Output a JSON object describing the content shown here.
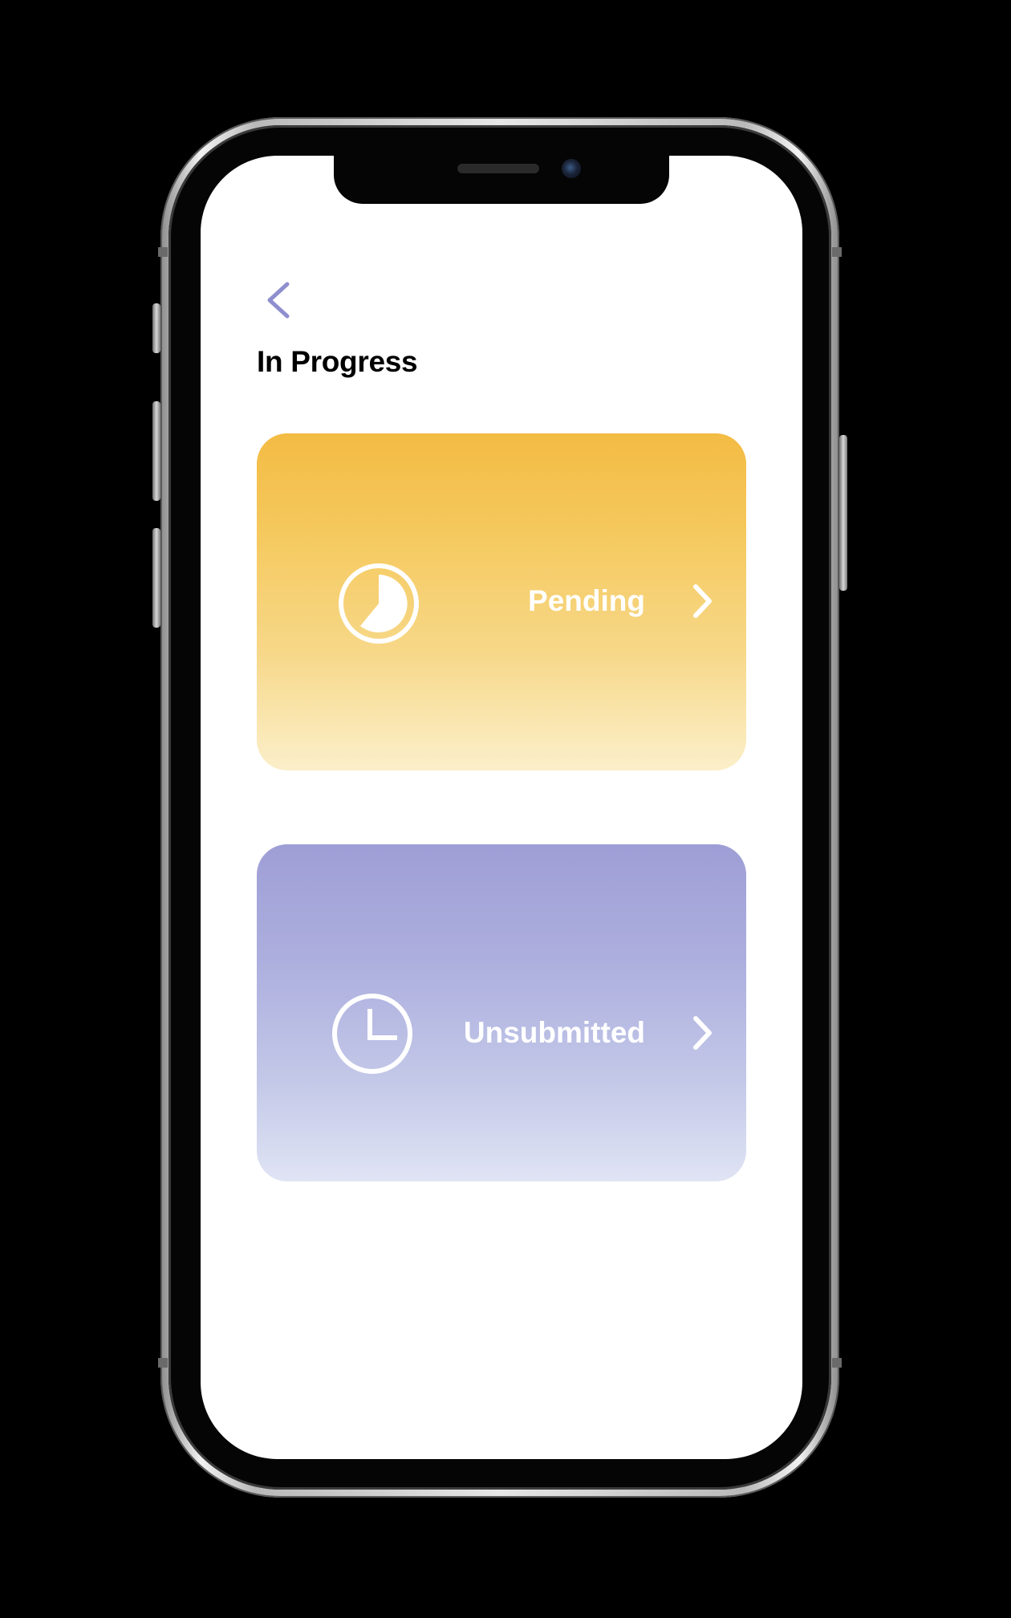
{
  "screen": {
    "title": "In Progress",
    "back_icon": "chevron-left-icon"
  },
  "cards": [
    {
      "label": "Pending",
      "icon": "pie-clock-icon",
      "chevron_icon": "chevron-right-icon",
      "gradient": [
        "#f3bb43",
        "#fbefca"
      ]
    },
    {
      "label": "Unsubmitted",
      "icon": "clock-icon",
      "chevron_icon": "chevron-right-icon",
      "gradient": [
        "#9e9ed6",
        "#e0e4f4"
      ]
    }
  ],
  "colors": {
    "accent": "#8e8ecf",
    "background": "#ffffff",
    "title": "#000000",
    "card_text": "#ffffff"
  }
}
